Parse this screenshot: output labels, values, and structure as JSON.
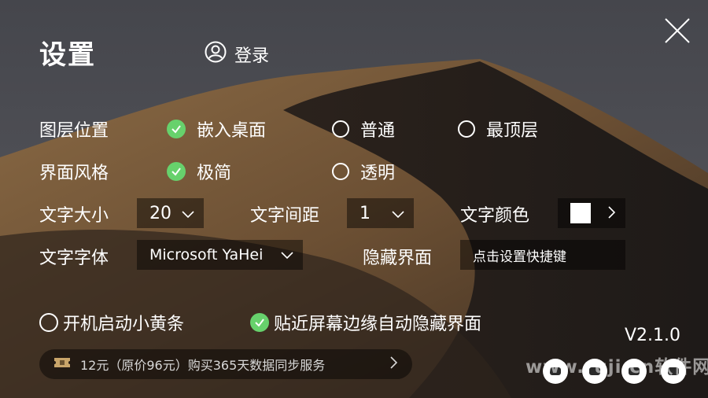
{
  "header": {
    "title": "设置",
    "login_label": "登录"
  },
  "layer_position": {
    "label": "图层位置",
    "options": [
      {
        "label": "嵌入桌面",
        "checked": true
      },
      {
        "label": "普通",
        "checked": false
      },
      {
        "label": "最顶层",
        "checked": false
      }
    ]
  },
  "ui_style": {
    "label": "界面风格",
    "options": [
      {
        "label": "极简",
        "checked": true
      },
      {
        "label": "透明",
        "checked": false
      }
    ]
  },
  "text": {
    "size_label": "文字大小",
    "size_value": "20",
    "spacing_label": "文字间距",
    "spacing_value": "1",
    "color_label": "文字颜色",
    "color_value": "#ffffff",
    "font_label": "文字字体",
    "font_value": "Microsoft YaHei"
  },
  "hide_ui": {
    "label": "隐藏界面",
    "hotkey_placeholder": "点击设置快捷键"
  },
  "options": {
    "autostart": {
      "label": "开机启动小黄条",
      "checked": false
    },
    "edge_hide": {
      "label": "贴近屏幕边缘自动隐藏界面",
      "checked": true
    }
  },
  "promo": {
    "icon": "ticket-icon",
    "text": "12元（原价96元）购买365天数据同步服务"
  },
  "version": "V2.1.0",
  "watermark": "www.ruji.cn软件网",
  "colors": {
    "check_green": "#67d16c",
    "panel_bg": "rgba(0,0,0,0.45)"
  }
}
